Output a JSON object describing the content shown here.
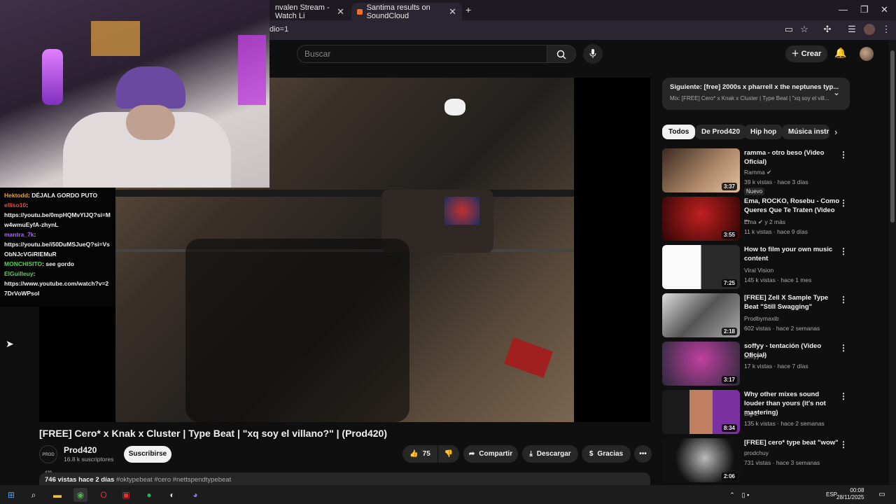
{
  "browser": {
    "tabs": [
      {
        "title": "nvalen Stream - Watch Li"
      },
      {
        "title": "Santima results on SoundCloud"
      }
    ],
    "url": "dio=1"
  },
  "header": {
    "search_placeholder": "Buscar",
    "create_label": "Crear"
  },
  "chat": {
    "messages": [
      {
        "user": "Hektodd",
        "text": ": DÉJALA GORDO PUTO",
        "color": "#f0a040"
      },
      {
        "user": "elliso10",
        "text": ":",
        "color": "#e05050"
      },
      {
        "user": "",
        "text": "https://youtu.be/0mpHQMvYIJQ?si=Mw4wmuEyfA-zhynL",
        "color": "#fff"
      },
      {
        "user": "mantra_7k",
        "text": ":",
        "color": "#a070f0"
      },
      {
        "user": "",
        "text": "https://youtu.be/i50DuMSJueQ?si=VsObNJcVGiRIEMuR",
        "color": "#fff"
      },
      {
        "user": "MONCHISITO",
        "text": ": see gordo",
        "color": "#60d060"
      },
      {
        "user": "ElGuilleuy",
        "text": ":",
        "color": "#60d060"
      },
      {
        "user": "",
        "text": "https://www.youtube.com/watch?v=27DrVoWPsol",
        "color": "#fff"
      }
    ]
  },
  "video": {
    "title": "[FREE] Cero* x Knak x Cluster | Type Beat | \"xq soy el villano?\" | (Prod420)",
    "channel": "Prod420",
    "channel_avatar_text": "PROD 420",
    "subscribers": "16.8 k suscriptores",
    "subscribe_label": "Suscribirse",
    "likes": "75",
    "share_label": "Compartir",
    "download_label": "Descargar",
    "thanks_label": "Gracias",
    "views_date": "746 vistas  hace 2 días",
    "tags": "#oktypebeat #cero #nettspendtypebeat"
  },
  "next_up": {
    "title": "Siguiente: [free] 2000s x pharrell x the neptunes typ...",
    "subtitle": "Mix: [FREE] Cero* x Knak x Cluster | Type Beat | \"xq soy el vill..."
  },
  "chips": [
    "Todos",
    "De Prod420",
    "Hip hop",
    "Música instr"
  ],
  "recommendations": [
    {
      "title": "ramma - otro beso (Video Oficial)",
      "channel": "Ramma",
      "meta": "39 k vistas · hace 3 días",
      "duration": "3:37",
      "badge": "Nuevo",
      "thumb_color": "#8a6a4a"
    },
    {
      "title": "Ema, ROCKO, Rosebu - Como Queres Que Te Traten (Video ...",
      "channel": "Ema",
      "channel_extra": "y 2 más",
      "meta": "11 k vistas · hace 9 días",
      "duration": "3:55",
      "thumb_color": "#6a1010"
    },
    {
      "title": "How to film your own music content",
      "channel": "Viral Vision",
      "meta": "145 k vistas · hace 1 mes",
      "duration": "7:25",
      "thumb_color": "#f0f0f0"
    },
    {
      "title": "[FREE] Zell X Sample Type Beat \"Still Swagging\"",
      "channel": "Prodbymaxib",
      "meta": "602 vistas · hace 2 semanas",
      "duration": "2:18",
      "thumb_color": "#888888"
    },
    {
      "title": "soffyy - tentación (Video Oficial)",
      "channel": "soffyy",
      "meta": "17 k vistas · hace 7 días",
      "duration": "3:17",
      "thumb_color": "#5a4a6a"
    },
    {
      "title": "Why other mixes sound louder than yours (it's not mastering)",
      "channel": "Big Z",
      "meta": "135 k vistas · hace 2 semanas",
      "duration": "8:34",
      "thumb_color": "#7a30a0"
    },
    {
      "title": "[FREE]  cero* type beat \"wow\"",
      "channel": "prodchuy",
      "meta": "731 vistas · hace 3 semanas",
      "duration": "2:06",
      "thumb_color": "#222222"
    }
  ],
  "taskbar": {
    "language": "ESP",
    "time": "00:08",
    "date": "28/11/2025"
  }
}
